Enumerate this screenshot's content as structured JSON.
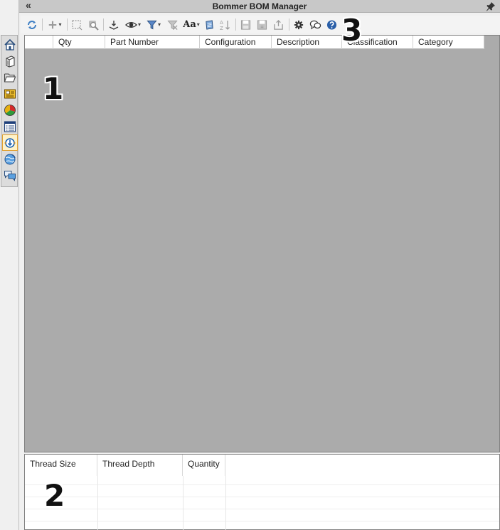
{
  "window": {
    "title": "Bommer BOM Manager",
    "collapse_glyph": "«"
  },
  "side_tabs": [
    {
      "icon": "home-icon"
    },
    {
      "icon": "parts-box-icon"
    },
    {
      "icon": "folder-icon"
    },
    {
      "icon": "properties-card-icon"
    },
    {
      "icon": "appearance-ball-icon"
    },
    {
      "icon": "list-view-icon"
    },
    {
      "icon": "bommer-icon",
      "active": true
    },
    {
      "icon": "globe-refresh-icon"
    },
    {
      "icon": "chat-bubbles-icon"
    }
  ],
  "toolbar": {
    "font_button_label": "Aa",
    "caret": "▾"
  },
  "bom_grid": {
    "columns": [
      "",
      "Qty",
      "Part Number",
      "Configuration",
      "Description",
      "Classification",
      "Category"
    ]
  },
  "thread_grid": {
    "columns": [
      "Thread Size",
      "Thread Depth",
      "Quantity"
    ]
  },
  "callouts": {
    "one": "1",
    "two": "2",
    "three": "3"
  },
  "colors": {
    "grid_background": "#ababab",
    "title_bar": "#c8c8c8",
    "help_blue": "#2a5fa8",
    "active_tab_highlight": "#fff2c8"
  }
}
